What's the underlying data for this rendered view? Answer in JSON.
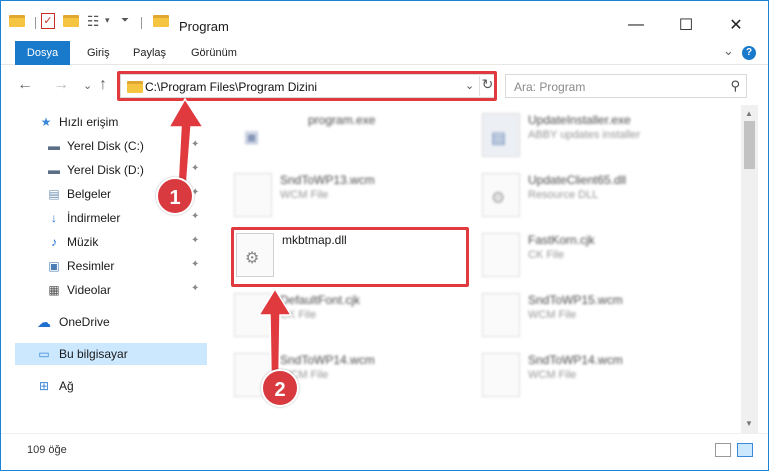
{
  "window": {
    "title": "Program"
  },
  "window_controls": {
    "minimize": "—",
    "maximize": "☐",
    "close": "✕"
  },
  "ribbon": {
    "tabs": [
      "Dosya",
      "Giriş",
      "Paylaş",
      "Görünüm"
    ],
    "help": "?",
    "expand": "⌄"
  },
  "nav": {
    "back": "←",
    "forward": "→",
    "recent": "⌄",
    "up": "↑"
  },
  "address": {
    "path": "C:\\Program Files\\Program Dizini",
    "dropdown": "⌄",
    "refresh": "↻"
  },
  "search": {
    "placeholder": "Ara: Program",
    "icon": "⚲"
  },
  "sidebar": {
    "items": [
      {
        "label": "Hızlı erişim",
        "icon": "star-icon",
        "glyph": "★",
        "color": "#3c88d8",
        "pinned": false
      },
      {
        "label": "Yerel Disk (C:)",
        "icon": "drive-icon",
        "glyph": "▬",
        "color": "#5a6e86",
        "pinned": true
      },
      {
        "label": "Yerel Disk (D:)",
        "icon": "drive-icon",
        "glyph": "▬",
        "color": "#5a6e86",
        "pinned": true
      },
      {
        "label": "Belgeler",
        "icon": "documents-icon",
        "glyph": "▤",
        "color": "#6f8fb0",
        "pinned": true
      },
      {
        "label": "İndirmeler",
        "icon": "downloads-icon",
        "glyph": "↓",
        "color": "#1f6fd1",
        "pinned": true
      },
      {
        "label": "Müzik",
        "icon": "music-icon",
        "glyph": "♪",
        "color": "#1f6fd1",
        "pinned": true
      },
      {
        "label": "Resimler",
        "icon": "pictures-icon",
        "glyph": "▣",
        "color": "#4a7db3",
        "pinned": true
      },
      {
        "label": "Videolar",
        "icon": "videos-icon",
        "glyph": "▦",
        "color": "#555555",
        "pinned": true
      },
      {
        "label": "OneDrive",
        "icon": "cloud-icon",
        "glyph": "☁",
        "color": "#1f6fd1",
        "pinned": false
      },
      {
        "label": "Bu bilgisayar",
        "icon": "computer-icon",
        "glyph": "▭",
        "color": "#3c88d8",
        "pinned": false
      },
      {
        "label": "Ağ",
        "icon": "network-icon",
        "glyph": "⊞",
        "color": "#3c88d8",
        "pinned": false
      }
    ],
    "pin_glyph": "📌"
  },
  "files": [
    {
      "name": "program.exe",
      "type": "",
      "icon": "exe-icon"
    },
    {
      "name": "UpdateInstaller.exe",
      "type": "ABBY updates installer",
      "icon": "installer-icon"
    },
    {
      "name": "SndToWP13.wcm",
      "type": "WCM File",
      "icon": "file-icon"
    },
    {
      "name": "UpdateClient65.dll",
      "type": "Resource DLL",
      "icon": "dll-icon"
    },
    {
      "name": "mkbtmap.dll",
      "type": "",
      "icon": "dll-icon"
    },
    {
      "name": "FastKorn.cjk",
      "type": "CK File",
      "icon": "file-icon"
    },
    {
      "name": "DefaultFont.cjk",
      "type": "CK File",
      "icon": "file-icon"
    },
    {
      "name": "SndToWP15.wcm",
      "type": "WCM File",
      "icon": "file-icon"
    },
    {
      "name": "SndToWP14.wcm",
      "type": "WCM File",
      "icon": "file-icon"
    },
    {
      "name": "SndToWP14.wcm",
      "type": "WCM File",
      "icon": "file-icon"
    }
  ],
  "status": {
    "count": "109 öğe"
  },
  "annotations": {
    "badge1": "1",
    "badge2": "2"
  },
  "colors": {
    "accent": "#1979ca",
    "highlight": "#e0393e",
    "selection": "#cce8ff"
  }
}
